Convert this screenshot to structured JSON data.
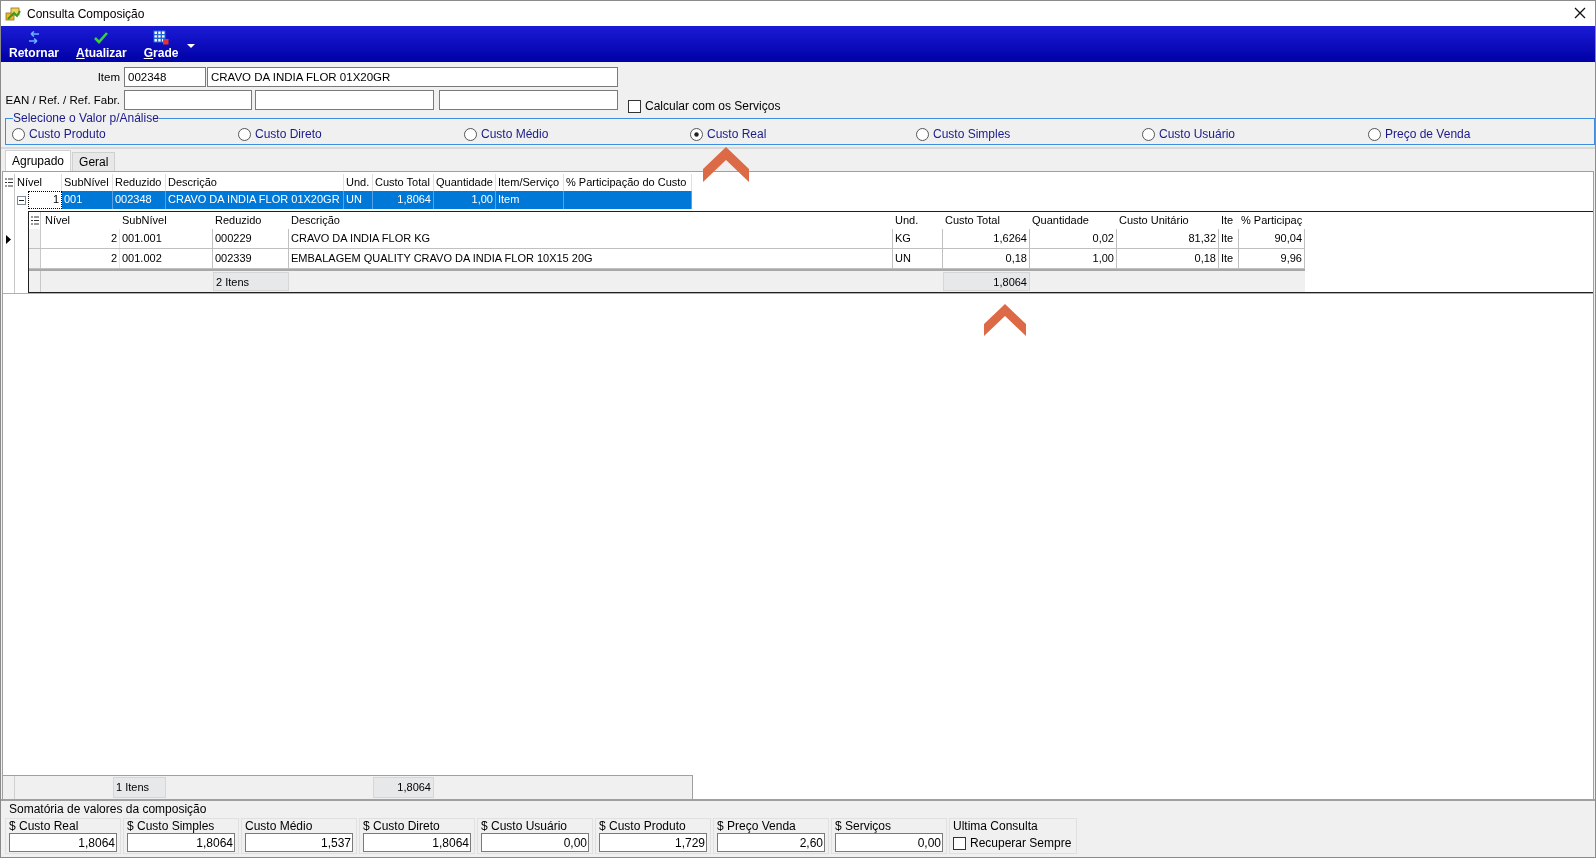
{
  "window": {
    "title": "Consulta Composição"
  },
  "toolbar": [
    {
      "label": "Retornar",
      "kind": "return",
      "mnemonic": false
    },
    {
      "label": "Atualizar",
      "kind": "check",
      "mnemonic": true
    },
    {
      "label": "Grade",
      "kind": "grid",
      "mnemonic": true,
      "dropdown": true
    }
  ],
  "item": {
    "label": "Item",
    "code": "002348",
    "description": "CRAVO DA INDIA FLOR 01X20GR"
  },
  "references": {
    "label": "EAN / Ref. / Ref. Fabr."
  },
  "services_checkbox": {
    "label": "Calcular com os Serviços",
    "checked": false
  },
  "value_group": {
    "title": "Selecione o Valor p/Análise",
    "options": [
      {
        "label": "Custo Produto",
        "selected": false
      },
      {
        "label": "Custo Direto",
        "selected": false
      },
      {
        "label": "Custo Médio",
        "selected": false
      },
      {
        "label": "Custo Real",
        "selected": true,
        "annotated": true
      },
      {
        "label": "Custo Simples",
        "selected": false
      },
      {
        "label": "Custo Usuário",
        "selected": false
      },
      {
        "label": "Preço de Venda",
        "selected": false
      }
    ]
  },
  "tabs": [
    {
      "label": "Agrupado",
      "selected": true
    },
    {
      "label": "Geral",
      "selected": false
    }
  ],
  "grid": {
    "columns": [
      "Nível",
      "SubNível",
      "Reduzido",
      "Descrição",
      "Und.",
      "Custo Total",
      "Quantidade",
      "Item/Serviço",
      "% Participação do Custo"
    ],
    "rows": [
      {
        "cells": [
          "1",
          "001",
          "002348",
          "CRAVO DA INDIA FLOR 01X20GR",
          "UN",
          "1,8064",
          "1,00",
          "Item"
        ],
        "selected": true,
        "expanded": true,
        "detail": {
          "columns": [
            "Nível",
            "SubNível",
            "Reduzido",
            "Descrição",
            "Und.",
            "Custo Total",
            "Quantidade",
            "Custo Unitário",
            "Ite",
            "% Participaç"
          ],
          "rows": [
            {
              "cells": [
                "2",
                "001.001",
                "000229",
                "CRAVO DA INDIA FLOR KG",
                "KG",
                "1,6264",
                "0,02",
                "81,32",
                "Ite",
                "90,04"
              ]
            },
            {
              "cells": [
                "2",
                "001.002",
                "002339",
                "EMBALAGEM QUALITY CRAVO DA INDIA FLOR 10X15 20G",
                "UN",
                "0,18",
                "1,00",
                "0,18",
                "Ite",
                "9,96"
              ]
            }
          ],
          "footer": {
            "count": "2 Itens",
            "total": "1,8064",
            "annotated": true
          }
        }
      }
    ],
    "footer": {
      "count": "1 Itens",
      "total": "1,8064"
    }
  },
  "summary": {
    "title": "Somatória de valores da composição",
    "fields": [
      {
        "label": "$ Custo Real",
        "value": "1,8064"
      },
      {
        "label": "$ Custo Simples",
        "value": "1,8064"
      },
      {
        "label": "Custo Médio",
        "value": "1,537"
      },
      {
        "label": "$ Custo Direto",
        "value": "1,8064"
      },
      {
        "label": "$ Custo Usuário",
        "value": "0,00"
      },
      {
        "label": "$ Custo Produto",
        "value": "1,729"
      },
      {
        "label": "$ Preço Venda",
        "value": "2,60"
      },
      {
        "label": "$ Serviços",
        "value": "0,00"
      }
    ],
    "last_query": {
      "title": "Ultima Consulta",
      "label": "Recuperar Sempre",
      "checked": false
    }
  }
}
